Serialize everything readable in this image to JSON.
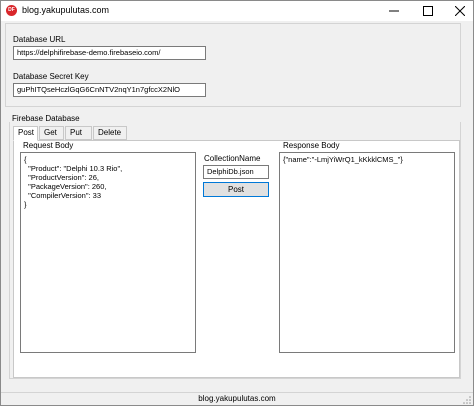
{
  "window": {
    "title": "blog.yakupulutas.com",
    "icon_text": "DF"
  },
  "settings": {
    "db_url_label": "Database URL",
    "db_url_value": "https://delphifirebase-demo.firebaseio.com/",
    "secret_label": "Database Secret Key",
    "secret_value": "guPhITQseHczlGqG6CnNTV2nqY1n7gfccX2NlO"
  },
  "database": {
    "group_label": "Firebase Database",
    "tabs": [
      {
        "label": "Post"
      },
      {
        "label": "Get"
      },
      {
        "label": "Put"
      },
      {
        "label": "Delete"
      }
    ],
    "active_tab": "Post",
    "request_body_label": "Request Body",
    "request_body": "{\n  \"Product\": \"Delphi 10.3 Rio\",\n  \"ProductVersion\": 26,\n  \"PackageVersion\": 260,\n  \"CompilerVersion\": 33\n}",
    "collection_label": "CollectionName",
    "collection_value": "DelphiDb.json",
    "post_button_label": "Post",
    "response_body_label": "Response Body",
    "response_body": "{\"name\":\"-LmjYiWrQ1_kKkklCMS_\"}"
  },
  "status": {
    "text": "blog.yakupulutas.com"
  }
}
